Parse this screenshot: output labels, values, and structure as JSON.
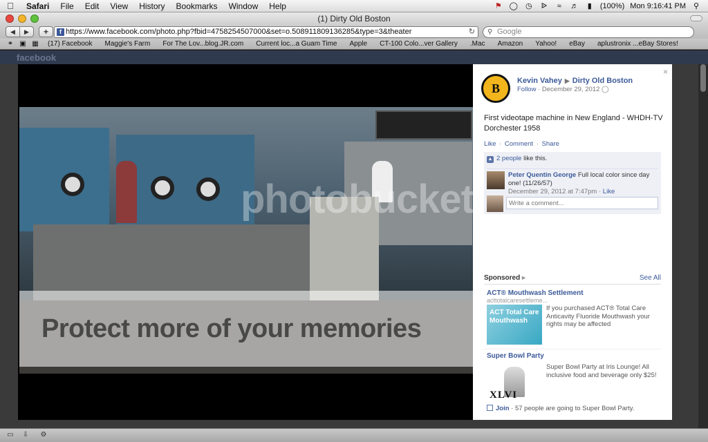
{
  "menubar": {
    "app": "Safari",
    "items": [
      "File",
      "Edit",
      "View",
      "History",
      "Bookmarks",
      "Window",
      "Help"
    ],
    "battery": "(100%)",
    "clock": "Mon 9:16:41 PM"
  },
  "window": {
    "title": "(1) Dirty Old Boston"
  },
  "toolbar": {
    "url": "https://www.facebook.com/photo.php?fbid=4758254507000&set=o.508911809136285&type=3&theater",
    "search_placeholder": "Google"
  },
  "bookmarks": [
    "(17) Facebook",
    "Maggie's Farm",
    "For The Lov...blog.JR.com",
    "Current loc...a Guam Time",
    "Apple",
    "CT-100 Colo...ver Gallery",
    ".Mac",
    "Amazon",
    "Yahoo!",
    "eBay",
    "aplustronix ...eBay Stores!"
  ],
  "photo": {
    "watermark_text": "Protect more of your memories"
  },
  "post": {
    "author": "Kevin Vahey",
    "group": "Dirty Old Boston",
    "follow_label": "Follow",
    "date": "December 29, 2012",
    "text": "First videotape machine in New England - WHDH-TV Dorchester 1958",
    "actions": {
      "like": "Like",
      "comment": "Comment",
      "share": "Share"
    },
    "likes": {
      "count_link": "2 people",
      "suffix": " like this."
    },
    "comment": {
      "author": "Peter Quentin George",
      "text": " Full local color since day one! (11/26/57)",
      "time": "December 29, 2012 at 7:47pm",
      "like_link": "Like"
    },
    "write_placeholder": "Write a comment..."
  },
  "sponsored": {
    "header": "Sponsored",
    "see_all": "See All",
    "ads": [
      {
        "title": "ACT® Mouthwash Settlement",
        "url": "acttotalcaresettleme...",
        "image_text": "ACT Total Care Mouthwash",
        "desc": "If you purchased ACT® Total Care Anticavity Fluoride Mouthwash your rights may be affected"
      },
      {
        "title": "Super Bowl Party",
        "image_text": "XLVI",
        "desc": "Super Bowl Party at Iris Lounge! All inclusive food and beverage only $25!",
        "join_label": "Join",
        "join_text": " · 57 people are going to Super Bowl Party."
      }
    ]
  },
  "icons": {
    "avatar_letter": "B"
  }
}
